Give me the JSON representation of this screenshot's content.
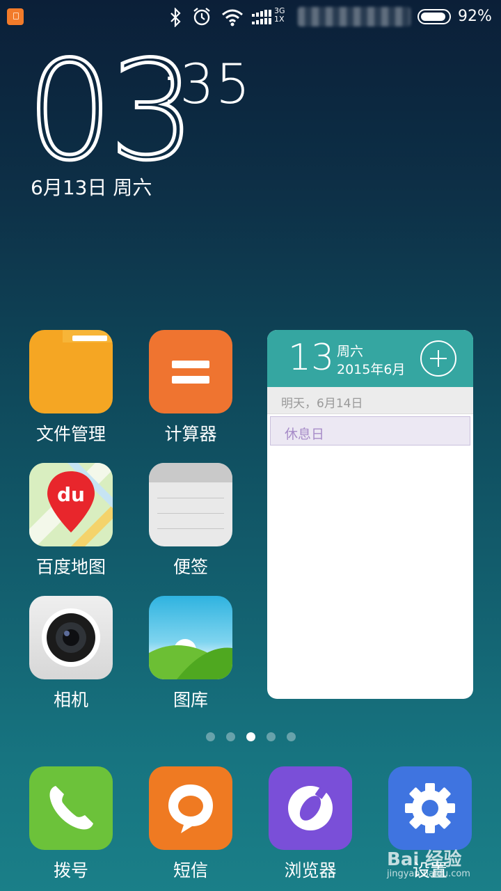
{
  "status_bar": {
    "network_top": "3G",
    "network_bottom": "1X",
    "battery_percent": "92%",
    "battery_level": 0.92,
    "icons": [
      "notification-icon",
      "bluetooth-icon",
      "alarm-icon",
      "wifi-icon",
      "signal-icon"
    ]
  },
  "clock": {
    "hours": "03",
    "minutes": ":35",
    "date": "6月13日 周六"
  },
  "apps": [
    {
      "label": "文件管理",
      "icon": "folder-icon"
    },
    {
      "label": "计算器",
      "icon": "calculator-icon"
    },
    {
      "label": "百度地图",
      "icon": "baidu-map-icon"
    },
    {
      "label": "便签",
      "icon": "notes-icon"
    },
    {
      "label": "相机",
      "icon": "camera-icon"
    },
    {
      "label": "图库",
      "icon": "gallery-icon"
    }
  ],
  "calendar_widget": {
    "day": "13",
    "weekday": "周六",
    "year_month": "2015年6月",
    "subheader": "明天，6月14日",
    "event": "休息日"
  },
  "page_indicator": {
    "count": 5,
    "active": 3
  },
  "dock": [
    {
      "label": "拨号",
      "icon": "phone-icon"
    },
    {
      "label": "短信",
      "icon": "sms-icon"
    },
    {
      "label": "浏览器",
      "icon": "browser-icon"
    },
    {
      "label": "设置",
      "icon": "settings-icon"
    }
  ],
  "watermark": {
    "brand": "Bai 经验",
    "url": "jingyan.baidu.com"
  },
  "colors": {
    "calendar_accent": "#35a6a1",
    "folder": "#f5a623",
    "calculator": "#ef7430",
    "phone": "#6cc23a",
    "sms": "#ef7a22",
    "browser": "#7a4fd8",
    "settings": "#3f74e0"
  }
}
